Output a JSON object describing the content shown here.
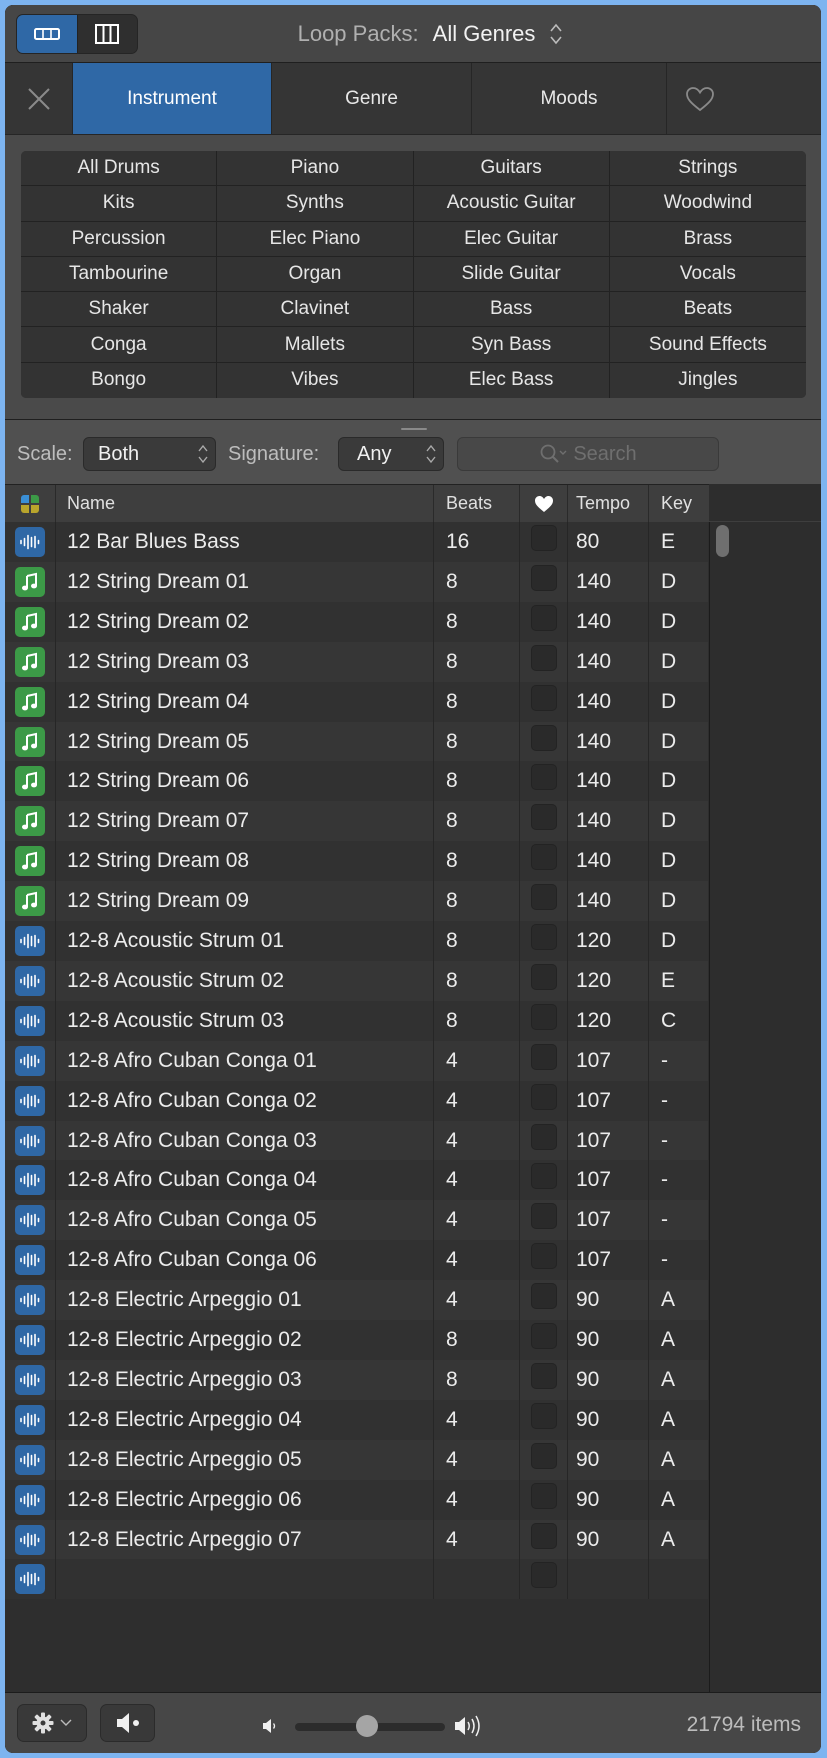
{
  "header": {
    "view_toggle": [
      {
        "name": "list-view",
        "icon": "list-view-icon",
        "active": true
      },
      {
        "name": "column-view",
        "icon": "column-view-icon",
        "active": false
      }
    ],
    "loop_packs_label": "Loop Packs:",
    "loop_packs_value": "All Genres"
  },
  "tabs": {
    "clear_icon": "close-icon",
    "items": [
      {
        "label": "Instrument",
        "active": true
      },
      {
        "label": "Genre",
        "active": false
      },
      {
        "label": "Moods",
        "active": false
      }
    ],
    "favorites_icon": "heart-icon"
  },
  "categories": [
    "All Drums",
    "Piano",
    "Guitars",
    "Strings",
    "Kits",
    "Synths",
    "Acoustic Guitar",
    "Woodwind",
    "Percussion",
    "Elec Piano",
    "Elec Guitar",
    "Brass",
    "Tambourine",
    "Organ",
    "Slide Guitar",
    "Vocals",
    "Shaker",
    "Clavinet",
    "Bass",
    "Beats",
    "Conga",
    "Mallets",
    "Syn Bass",
    "Sound Effects",
    "Bongo",
    "Vibes",
    "Elec Bass",
    "Jingles"
  ],
  "filters": {
    "scale_label": "Scale:",
    "scale_value": "Both",
    "signature_label": "Signature:",
    "signature_value": "Any",
    "search_placeholder": "Search"
  },
  "table": {
    "columns": {
      "type_icon": "loop-type-icon",
      "name": "Name",
      "beats": "Beats",
      "fav": "heart-icon",
      "tempo": "Tempo",
      "key": "Key"
    },
    "rows": [
      {
        "type": "audio",
        "name": "12 Bar Blues Bass",
        "beats": "16",
        "tempo": "80",
        "key": "E"
      },
      {
        "type": "midi",
        "name": "12 String Dream 01",
        "beats": "8",
        "tempo": "140",
        "key": "D"
      },
      {
        "type": "midi",
        "name": "12 String Dream 02",
        "beats": "8",
        "tempo": "140",
        "key": "D"
      },
      {
        "type": "midi",
        "name": "12 String Dream 03",
        "beats": "8",
        "tempo": "140",
        "key": "D"
      },
      {
        "type": "midi",
        "name": "12 String Dream 04",
        "beats": "8",
        "tempo": "140",
        "key": "D"
      },
      {
        "type": "midi",
        "name": "12 String Dream 05",
        "beats": "8",
        "tempo": "140",
        "key": "D"
      },
      {
        "type": "midi",
        "name": "12 String Dream 06",
        "beats": "8",
        "tempo": "140",
        "key": "D"
      },
      {
        "type": "midi",
        "name": "12 String Dream 07",
        "beats": "8",
        "tempo": "140",
        "key": "D"
      },
      {
        "type": "midi",
        "name": "12 String Dream 08",
        "beats": "8",
        "tempo": "140",
        "key": "D"
      },
      {
        "type": "midi",
        "name": "12 String Dream 09",
        "beats": "8",
        "tempo": "140",
        "key": "D"
      },
      {
        "type": "audio",
        "name": "12-8 Acoustic Strum 01",
        "beats": "8",
        "tempo": "120",
        "key": "D"
      },
      {
        "type": "audio",
        "name": "12-8 Acoustic Strum 02",
        "beats": "8",
        "tempo": "120",
        "key": "E"
      },
      {
        "type": "audio",
        "name": "12-8 Acoustic Strum 03",
        "beats": "8",
        "tempo": "120",
        "key": "C"
      },
      {
        "type": "audio",
        "name": "12-8 Afro Cuban Conga 01",
        "beats": "4",
        "tempo": "107",
        "key": "-"
      },
      {
        "type": "audio",
        "name": "12-8 Afro Cuban Conga 02",
        "beats": "4",
        "tempo": "107",
        "key": "-"
      },
      {
        "type": "audio",
        "name": "12-8 Afro Cuban Conga 03",
        "beats": "4",
        "tempo": "107",
        "key": "-"
      },
      {
        "type": "audio",
        "name": "12-8 Afro Cuban Conga 04",
        "beats": "4",
        "tempo": "107",
        "key": "-"
      },
      {
        "type": "audio",
        "name": "12-8 Afro Cuban Conga 05",
        "beats": "4",
        "tempo": "107",
        "key": "-"
      },
      {
        "type": "audio",
        "name": "12-8 Afro Cuban Conga 06",
        "beats": "4",
        "tempo": "107",
        "key": "-"
      },
      {
        "type": "audio",
        "name": "12-8 Electric Arpeggio 01",
        "beats": "4",
        "tempo": "90",
        "key": "A"
      },
      {
        "type": "audio",
        "name": "12-8 Electric Arpeggio 02",
        "beats": "8",
        "tempo": "90",
        "key": "A"
      },
      {
        "type": "audio",
        "name": "12-8 Electric Arpeggio 03",
        "beats": "8",
        "tempo": "90",
        "key": "A"
      },
      {
        "type": "audio",
        "name": "12-8 Electric Arpeggio 04",
        "beats": "4",
        "tempo": "90",
        "key": "A"
      },
      {
        "type": "audio",
        "name": "12-8 Electric Arpeggio 05",
        "beats": "4",
        "tempo": "90",
        "key": "A"
      },
      {
        "type": "audio",
        "name": "12-8 Electric Arpeggio 06",
        "beats": "4",
        "tempo": "90",
        "key": "A"
      },
      {
        "type": "audio",
        "name": "12-8 Electric Arpeggio 07",
        "beats": "4",
        "tempo": "90",
        "key": "A"
      },
      {
        "type": "audio",
        "name": "",
        "beats": "",
        "tempo": "",
        "key": ""
      }
    ]
  },
  "footer": {
    "settings_icon": "gear-icon",
    "preview_icon": "speaker-icon",
    "volume_low_icon": "volume-low-icon",
    "volume_high_icon": "volume-high-icon",
    "volume_fraction": 0.48,
    "item_count": "21794 items"
  },
  "colors": {
    "accent": "#2f68a6",
    "audio_loop": "#2f68a6",
    "midi_loop": "#3c9a47"
  }
}
